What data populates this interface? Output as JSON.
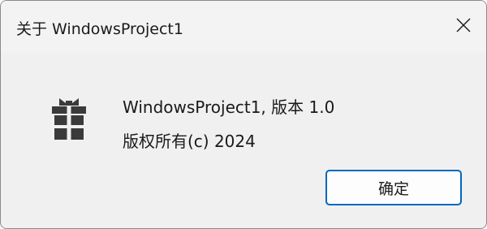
{
  "window": {
    "title": "关于 WindowsProject1",
    "close_icon": "close-icon"
  },
  "content": {
    "app_icon": "gift-box-icon",
    "version_text": "WindowsProject1, 版本 1.0",
    "copyright_text": "版权所有(c) 2024"
  },
  "buttons": {
    "ok_label": "确定"
  },
  "colors": {
    "accent": "#0067c0",
    "icon": "#3a3a3a"
  }
}
